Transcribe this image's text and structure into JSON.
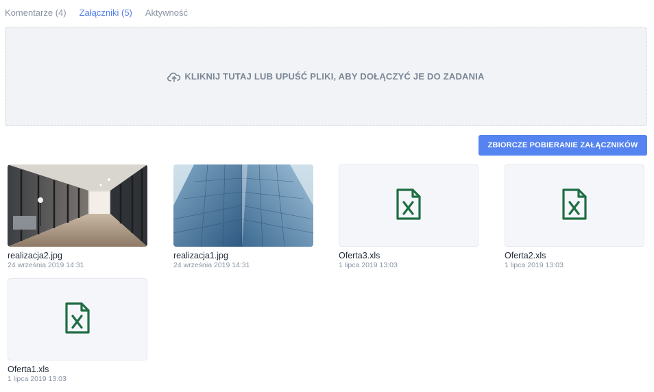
{
  "tabs": [
    {
      "label": "Komentarze (4)",
      "active": false
    },
    {
      "label": "Załączniki (5)",
      "active": true
    },
    {
      "label": "Aktywność",
      "active": false
    }
  ],
  "dropzone": {
    "icon": "cloud-upload-icon",
    "label": "KLIKNIJ TUTAJ LUB UPUŚĆ PLIKI, ABY DOŁĄCZYĆ JE DO ZADANIA"
  },
  "bulk_download": {
    "label": "ZBIORCZE POBIERANIE ZAŁĄCZNIKÓW"
  },
  "colors": {
    "accent": "#5584f0",
    "excel_green": "#1f6e43"
  },
  "files": [
    {
      "name": "realizacja2.jpg",
      "date": "24 września 2019 14:31",
      "type": "image"
    },
    {
      "name": "realizacja1.jpg",
      "date": "24 września 2019 14:31",
      "type": "image"
    },
    {
      "name": "Oferta3.xls",
      "date": "1 lipca 2019 13:03",
      "type": "excel",
      "icon": "excel-file-icon"
    },
    {
      "name": "Oferta2.xls",
      "date": "1 lipca 2019 13:03",
      "type": "excel",
      "icon": "excel-file-icon"
    },
    {
      "name": "Oferta1.xls",
      "date": "1 lipca 2019 13:03",
      "type": "excel",
      "icon": "excel-file-icon"
    }
  ]
}
